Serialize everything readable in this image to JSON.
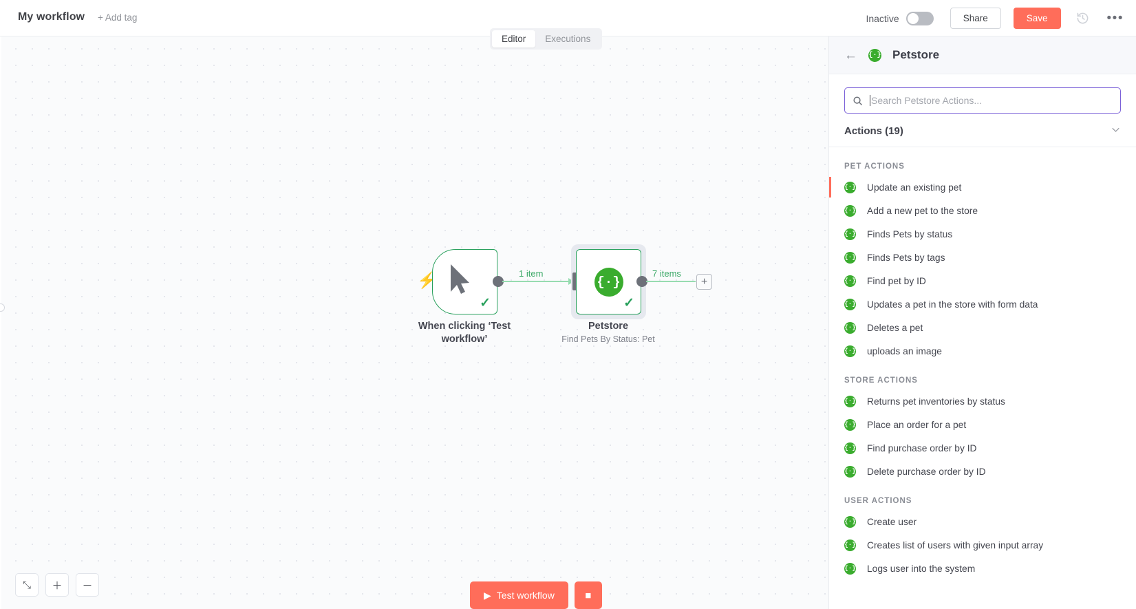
{
  "topbar": {
    "workflow_title": "My workflow",
    "add_tag_label": "+ Add tag",
    "tabs": [
      {
        "label": "Editor",
        "active": true
      },
      {
        "label": "Executions",
        "active": false
      }
    ],
    "activation_state_label": "Inactive",
    "share_label": "Share",
    "save_label": "Save",
    "history_icon": "history-icon",
    "more_icon": "more-options-icon"
  },
  "canvas": {
    "nodes": [
      {
        "name": "When clicking 'Test workflow'",
        "label_line1": "When clicking ‘Test",
        "label_line2": "workflow’",
        "subtitle": "",
        "type": "manual-trigger",
        "icon": "cursor-pointer-icon",
        "status": "success",
        "selected": false
      },
      {
        "name": "Petstore",
        "label_line1": "Petstore",
        "label_line2": "",
        "subtitle": "Find Pets By Status: Pet",
        "type": "petstore",
        "icon": "petstore-braces-icon",
        "status": "success",
        "selected": true
      }
    ],
    "connections": [
      {
        "from": "When clicking 'Test workflow'",
        "to": "Petstore",
        "label": "1 item"
      },
      {
        "from": "Petstore",
        "to": "",
        "label": "7 items"
      }
    ],
    "add_node_label": "+",
    "zoom_controls": [
      {
        "icon": "zoom-fit-icon",
        "glyph": "⤡"
      },
      {
        "icon": "zoom-in-icon",
        "glyph": "＋"
      },
      {
        "icon": "zoom-out-icon",
        "glyph": "－"
      }
    ],
    "run_button_label": "Test workflow",
    "run_button_icon": "play-icon",
    "stop_button_icon": "stop-icon"
  },
  "panel": {
    "back_icon": "back-arrow-icon",
    "node_icon": "petstore-braces-icon",
    "title": "Petstore",
    "search": {
      "placeholder": "Search Petstore Actions...",
      "value": "",
      "icon": "search-icon"
    },
    "actions_header": {
      "label": "Actions (19)",
      "count": 19,
      "chevron_icon": "chevron-down-icon"
    },
    "groups": [
      {
        "title": "PET ACTIONS",
        "items": [
          {
            "label": "Update an existing pet",
            "active": true
          },
          {
            "label": "Add a new pet to the store",
            "active": false
          },
          {
            "label": "Finds Pets by status",
            "active": false
          },
          {
            "label": "Finds Pets by tags",
            "active": false
          },
          {
            "label": "Find pet by ID",
            "active": false
          },
          {
            "label": "Updates a pet in the store with form data",
            "active": false
          },
          {
            "label": "Deletes a pet",
            "active": false
          },
          {
            "label": "uploads an image",
            "active": false
          }
        ]
      },
      {
        "title": "STORE ACTIONS",
        "items": [
          {
            "label": "Returns pet inventories by status",
            "active": false
          },
          {
            "label": "Place an order for a pet",
            "active": false
          },
          {
            "label": "Find purchase order by ID",
            "active": false
          },
          {
            "label": "Delete purchase order by ID",
            "active": false
          }
        ]
      },
      {
        "title": "USER ACTIONS",
        "items": [
          {
            "label": "Create user",
            "active": false
          },
          {
            "label": "Creates list of users with given input array",
            "active": false
          },
          {
            "label": "Logs user into the system",
            "active": false
          }
        ]
      }
    ]
  },
  "colors": {
    "accent_coral": "#ff6d5a",
    "node_green": "#28a05c",
    "logo_green": "#3aac2e",
    "connection_green": "#97dcb0",
    "focus_purple": "#7b61d8",
    "canvas_bg": "#fafbfc"
  }
}
